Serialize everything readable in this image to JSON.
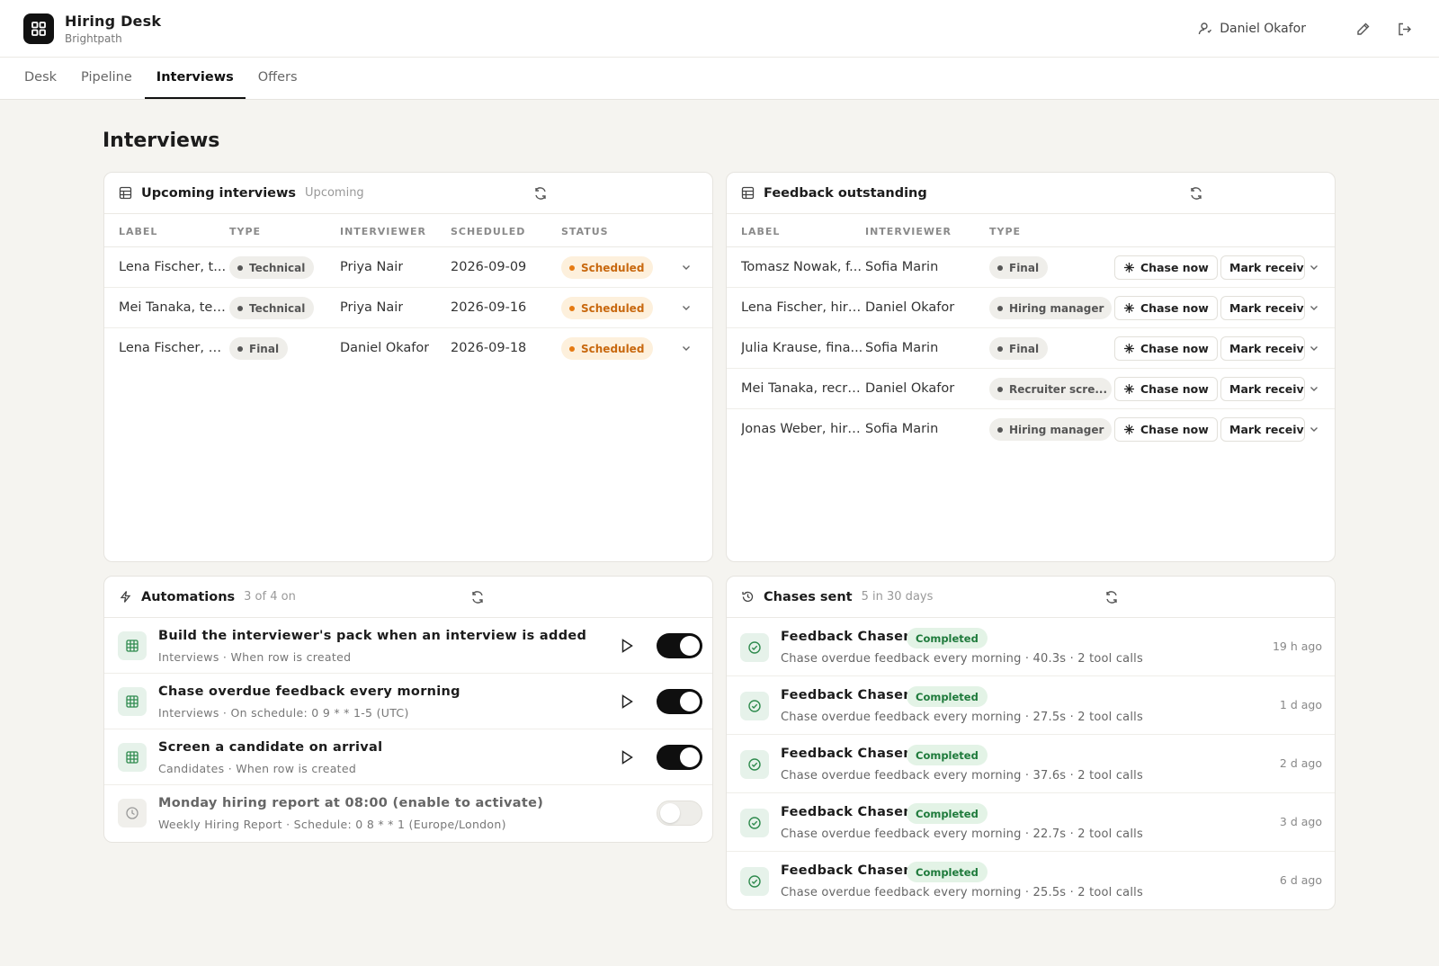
{
  "app": {
    "title": "Hiring Desk",
    "org": "Brightpath",
    "user": "Daniel Okafor"
  },
  "tabs": [
    {
      "label": "Desk"
    },
    {
      "label": "Pipeline"
    },
    {
      "label": "Interviews",
      "active": true
    },
    {
      "label": "Offers"
    }
  ],
  "page": {
    "title": "Interviews"
  },
  "upcoming": {
    "title": "Upcoming interviews",
    "subtitle": "Upcoming",
    "columns": [
      "LABEL",
      "TYPE",
      "INTERVIEWER",
      "SCHEDULED",
      "STATUS"
    ],
    "rows": [
      {
        "label": "Lena Fischer, t...",
        "type": "Technical",
        "interviewer": "Priya Nair",
        "scheduled": "2026-09-09",
        "status": "Scheduled"
      },
      {
        "label": "Mei Tanaka, tec...",
        "type": "Technical",
        "interviewer": "Priya Nair",
        "scheduled": "2026-09-16",
        "status": "Scheduled"
      },
      {
        "label": "Lena Fischer, fi...",
        "type": "Final",
        "interviewer": "Daniel Okafor",
        "scheduled": "2026-09-18",
        "status": "Scheduled"
      }
    ]
  },
  "feedback": {
    "title": "Feedback outstanding",
    "columns": [
      "LABEL",
      "INTERVIEWER",
      "TYPE"
    ],
    "chase_label": "Chase now",
    "mark_label": "Mark receiv",
    "rows": [
      {
        "label": "Tomasz Nowak, f...",
        "interviewer": "Sofia Marin",
        "type": "Final"
      },
      {
        "label": "Lena Fischer, hiri...",
        "interviewer": "Daniel Okafor",
        "type": "Hiring manager"
      },
      {
        "label": "Julia Krause, fina...",
        "interviewer": "Sofia Marin",
        "type": "Final"
      },
      {
        "label": "Mei Tanaka, recru...",
        "interviewer": "Daniel Okafor",
        "type": "Recruiter scre..."
      },
      {
        "label": "Jonas Weber, hiri...",
        "interviewer": "Sofia Marin",
        "type": "Hiring manager"
      }
    ]
  },
  "automations": {
    "title": "Automations",
    "subtitle": "3 of 4 on",
    "items": [
      {
        "title": "Build the interviewer's pack when an interview is added",
        "sub": "Interviews · When row is created",
        "on": true,
        "icon": "table-icon"
      },
      {
        "title": "Chase overdue feedback every morning",
        "sub": "Interviews · On schedule: 0 9 * * 1-5 (UTC)",
        "on": true,
        "icon": "table-icon"
      },
      {
        "title": "Screen a candidate on arrival",
        "sub": "Candidates · When row is created",
        "on": true,
        "icon": "table-icon"
      },
      {
        "title": "Monday hiring report at 08:00 (enable to activate)",
        "sub": "Weekly Hiring Report · Schedule: 0 8 * * 1 (Europe/London)",
        "on": false,
        "icon": "clock-icon"
      }
    ]
  },
  "chases": {
    "title": "Chases sent",
    "subtitle": "5 in 30 days",
    "items": [
      {
        "name": "Feedback Chaser",
        "status": "Completed",
        "detail": "Chase overdue feedback every morning · 40.3s · 2 tool calls",
        "time": "19 h ago"
      },
      {
        "name": "Feedback Chaser",
        "status": "Completed",
        "detail": "Chase overdue feedback every morning · 27.5s · 2 tool calls",
        "time": "1 d ago"
      },
      {
        "name": "Feedback Chaser",
        "status": "Completed",
        "detail": "Chase overdue feedback every morning · 37.6s · 2 tool calls",
        "time": "2 d ago"
      },
      {
        "name": "Feedback Chaser",
        "status": "Completed",
        "detail": "Chase overdue feedback every morning · 22.7s · 2 tool calls",
        "time": "3 d ago"
      },
      {
        "name": "Feedback Chaser",
        "status": "Completed",
        "detail": "Chase overdue feedback every morning · 25.5s · 2 tool calls",
        "time": "6 d ago"
      }
    ]
  }
}
